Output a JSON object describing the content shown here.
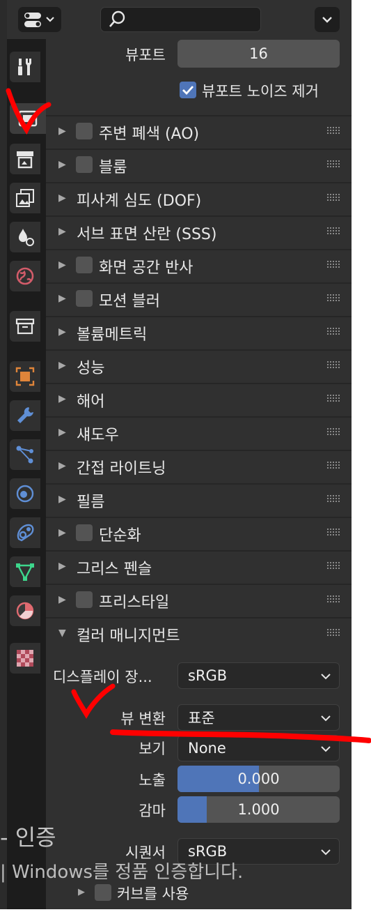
{
  "header": {
    "editor_icon": "properties-editor-icon",
    "search_icon": "search-icon",
    "search_placeholder": "",
    "options_icon": "chevron-down-icon"
  },
  "tabs": [
    {
      "name": "tool",
      "icon": "tool-icon"
    },
    {
      "name": "render",
      "icon": "render-icon",
      "active": true
    },
    {
      "name": "output",
      "icon": "output-icon"
    },
    {
      "name": "view-layer",
      "icon": "view-layer-icon"
    },
    {
      "name": "scene",
      "icon": "scene-icon"
    },
    {
      "name": "world",
      "icon": "world-icon"
    },
    {
      "name": "collection",
      "icon": "collection-icon"
    },
    {
      "name": "object",
      "icon": "object-icon"
    },
    {
      "name": "modifiers",
      "icon": "wrench-icon"
    },
    {
      "name": "particles",
      "icon": "particles-icon"
    },
    {
      "name": "physics",
      "icon": "physics-icon"
    },
    {
      "name": "constraints",
      "icon": "constraints-icon"
    },
    {
      "name": "data",
      "icon": "vertex-data-icon"
    },
    {
      "name": "material",
      "icon": "material-icon"
    },
    {
      "name": "texture",
      "icon": "texture-icon"
    }
  ],
  "sampling": {
    "viewport_label": "뷰포트",
    "viewport_value": "16",
    "denoise_label": "뷰포트 노이즈 제거",
    "denoise_checked": true
  },
  "panels": [
    {
      "title": "주변 폐색 (AO)",
      "checkbox": true
    },
    {
      "title": "블룸",
      "checkbox": true
    },
    {
      "title": "피사계 심도 (DOF)",
      "checkbox": false
    },
    {
      "title": "서브 표면 산란 (SSS)",
      "checkbox": false
    },
    {
      "title": "화면 공간 반사",
      "checkbox": true
    },
    {
      "title": "모션 블러",
      "checkbox": true
    },
    {
      "title": "볼륨메트릭",
      "checkbox": false
    },
    {
      "title": "성능",
      "checkbox": false
    },
    {
      "title": "해어",
      "checkbox": false
    },
    {
      "title": "섀도우",
      "checkbox": false
    },
    {
      "title": "간접 라이트닝",
      "checkbox": false
    },
    {
      "title": "필름",
      "checkbox": false
    },
    {
      "title": "단순화",
      "checkbox": true
    },
    {
      "title": "그리스 펜슬",
      "checkbox": false
    },
    {
      "title": "프리스타일",
      "checkbox": true
    },
    {
      "title": "컬러 매니지먼트",
      "checkbox": false,
      "expanded": true
    }
  ],
  "color_management": {
    "display_label": "디스플레이 장...",
    "display_value": "sRGB",
    "view_transform_label": "뷰 변환",
    "view_transform_value": "표준",
    "look_label": "보기",
    "look_value": "None",
    "exposure_label": "노출",
    "exposure_value": "0.000",
    "exposure_fill": 0.5,
    "gamma_label": "감마",
    "gamma_value": "1.000",
    "gamma_fill": 0.18,
    "sequencer_label": "시퀀서",
    "sequencer_value": "sRGB",
    "curves_label": "커브를 사용",
    "curves_checked": false
  },
  "watermark": {
    "line1": "- 인증",
    "line2": "| Windows를 정품 인증합니다."
  },
  "annotation_color": "#ff0000",
  "accent_color": "#4f75b8"
}
